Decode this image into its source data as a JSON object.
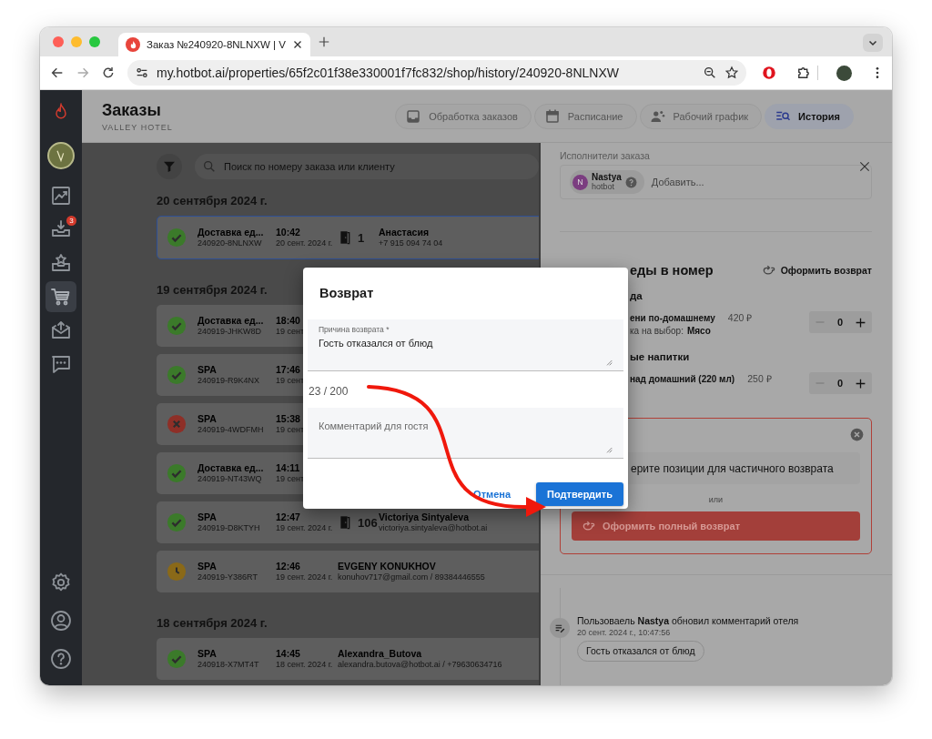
{
  "browser": {
    "tab_title": "Заказ №240920-8NLNXW | V",
    "url": "my.hotbot.ai/properties/65f2c01f38e330001f7fc832/shop/history/240920-8NLNXW"
  },
  "sidebar": {
    "items": [
      {
        "kind": "chart",
        "selected": false
      },
      {
        "kind": "download",
        "selected": false,
        "badge": "3"
      },
      {
        "kind": "tray-star",
        "selected": false
      },
      {
        "kind": "cart",
        "selected": true
      },
      {
        "kind": "envelope",
        "selected": false
      },
      {
        "kind": "chat",
        "selected": false
      }
    ],
    "bottom_items": [
      {
        "kind": "settings"
      },
      {
        "kind": "user"
      },
      {
        "kind": "help"
      }
    ]
  },
  "header": {
    "title": "Заказы",
    "subtitle": "VALLEY HOTEL",
    "tabs": [
      {
        "label": "Обработка заказов",
        "kind": "inbox",
        "selected": false
      },
      {
        "label": "Расписание",
        "kind": "calendar",
        "selected": false
      },
      {
        "label": "Рабочий график",
        "kind": "people",
        "selected": false
      },
      {
        "label": "История",
        "kind": "history",
        "selected": true
      }
    ]
  },
  "search": {
    "placeholder": "Поиск по номеру заказа или клиенту"
  },
  "order_groups": [
    {
      "date": "20 сентября 2024 г.",
      "orders": [
        {
          "kind": "done",
          "service": "Доставка ед...",
          "code": "240920-8NLNXW",
          "time": "10:42",
          "date": "20 сент. 2024 г.",
          "room": "1",
          "client": "Анастасия",
          "contact": "+7 915 094 74 04",
          "selected": true
        }
      ]
    },
    {
      "date": "19 сентября 2024 г.",
      "orders": [
        {
          "kind": "done",
          "service": "Доставка ед...",
          "code": "240919-JHKW8D",
          "time": "18:40",
          "date": "19 сент",
          "selected": false
        },
        {
          "kind": "done",
          "service": "SPA",
          "code": "240919-R9K4NX",
          "time": "17:46",
          "date": "19 сент",
          "selected": false
        },
        {
          "kind": "cancelled",
          "service": "SPA",
          "code": "240919-4WDFMH",
          "time": "15:38",
          "date": "19 сент",
          "selected": false
        },
        {
          "kind": "done",
          "service": "Доставка ед...",
          "code": "240919-NT43WQ",
          "time": "14:11",
          "date": "19 сент",
          "selected": false
        },
        {
          "kind": "done",
          "service": "SPA",
          "code": "240919-D8KTYH",
          "time": "12:47",
          "date": "19 сент. 2024 г.",
          "room": "106",
          "client": "Victoriya Sintyaleva",
          "contact": "victoriya.sintyaleva@hotbot.ai",
          "selected": false
        },
        {
          "kind": "pending",
          "service": "SPA",
          "code": "240919-Y386RT",
          "time": "12:46",
          "date": "19 сент. 2024 г.",
          "client": "EVGENY KONUKHOV",
          "contact": "konuhov717@gmail.com / 89384446555",
          "selected": false
        }
      ]
    },
    {
      "date": "18 сентября 2024 г.",
      "orders": [
        {
          "kind": "done",
          "service": "SPA",
          "code": "240918-X7MT4T",
          "time": "14:45",
          "date": "18 сент. 2024 г.",
          "client": "Alexandra_Butova",
          "contact": "alexandra.butova@hotbot.ai / +79630634716",
          "selected": false
        }
      ]
    }
  ],
  "detail": {
    "executors": {
      "label": "Исполнители заказа",
      "chips": [
        {
          "initial": "N",
          "name": "Nastya",
          "org": "hotbot"
        }
      ],
      "placeholder": "Добавить..."
    },
    "section_title": "еды в номер",
    "refund_action": "Оформить возврат",
    "categories": [
      {
        "title": "да",
        "items": [
          {
            "name": "ени по-домашнему",
            "price": "420 ₽",
            "option_label": "ка на выбор:",
            "option_value": "Мясо",
            "qty": "0"
          }
        ]
      },
      {
        "title": "ые напитки",
        "items": [
          {
            "name": "над домашний (220 мл)",
            "price": "250 ₽",
            "qty": "0"
          }
        ]
      }
    ],
    "refund_box": {
      "partial": "ерите позиции для частичного возврата",
      "or": "или",
      "full": "Оформить полный возврат"
    },
    "history": [
      {
        "text": "Пользоваель **Nastya** обновил комментарий отеля",
        "time": "20 сент. 2024 г., 10:47:56",
        "comment": "Гость отказался от блюд"
      }
    ]
  },
  "dialog": {
    "title": "Возврат",
    "reason_label": "Причина возврата *",
    "reason_value": "Гость отказался от блюд",
    "counter": "23 / 200",
    "comment_placeholder": "Комментарий для гостя",
    "cancel": "Отмена",
    "confirm": "Подтвердить"
  }
}
